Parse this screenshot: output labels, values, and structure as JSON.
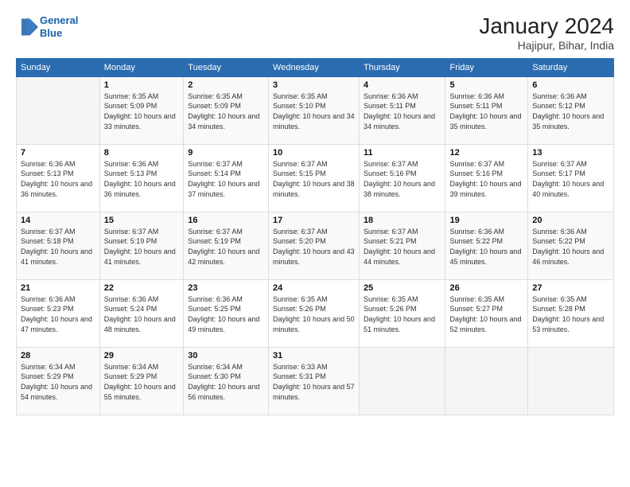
{
  "logo": {
    "line1": "General",
    "line2": "Blue"
  },
  "title": "January 2024",
  "subtitle": "Hajipur, Bihar, India",
  "days_header": [
    "Sunday",
    "Monday",
    "Tuesday",
    "Wednesday",
    "Thursday",
    "Friday",
    "Saturday"
  ],
  "weeks": [
    [
      {
        "num": "",
        "sunrise": "",
        "sunset": "",
        "daylight": ""
      },
      {
        "num": "1",
        "sunrise": "Sunrise: 6:35 AM",
        "sunset": "Sunset: 5:09 PM",
        "daylight": "Daylight: 10 hours and 33 minutes."
      },
      {
        "num": "2",
        "sunrise": "Sunrise: 6:35 AM",
        "sunset": "Sunset: 5:09 PM",
        "daylight": "Daylight: 10 hours and 34 minutes."
      },
      {
        "num": "3",
        "sunrise": "Sunrise: 6:35 AM",
        "sunset": "Sunset: 5:10 PM",
        "daylight": "Daylight: 10 hours and 34 minutes."
      },
      {
        "num": "4",
        "sunrise": "Sunrise: 6:36 AM",
        "sunset": "Sunset: 5:11 PM",
        "daylight": "Daylight: 10 hours and 34 minutes."
      },
      {
        "num": "5",
        "sunrise": "Sunrise: 6:36 AM",
        "sunset": "Sunset: 5:11 PM",
        "daylight": "Daylight: 10 hours and 35 minutes."
      },
      {
        "num": "6",
        "sunrise": "Sunrise: 6:36 AM",
        "sunset": "Sunset: 5:12 PM",
        "daylight": "Daylight: 10 hours and 35 minutes."
      }
    ],
    [
      {
        "num": "7",
        "sunrise": "Sunrise: 6:36 AM",
        "sunset": "Sunset: 5:13 PM",
        "daylight": "Daylight: 10 hours and 36 minutes."
      },
      {
        "num": "8",
        "sunrise": "Sunrise: 6:36 AM",
        "sunset": "Sunset: 5:13 PM",
        "daylight": "Daylight: 10 hours and 36 minutes."
      },
      {
        "num": "9",
        "sunrise": "Sunrise: 6:37 AM",
        "sunset": "Sunset: 5:14 PM",
        "daylight": "Daylight: 10 hours and 37 minutes."
      },
      {
        "num": "10",
        "sunrise": "Sunrise: 6:37 AM",
        "sunset": "Sunset: 5:15 PM",
        "daylight": "Daylight: 10 hours and 38 minutes."
      },
      {
        "num": "11",
        "sunrise": "Sunrise: 6:37 AM",
        "sunset": "Sunset: 5:16 PM",
        "daylight": "Daylight: 10 hours and 38 minutes."
      },
      {
        "num": "12",
        "sunrise": "Sunrise: 6:37 AM",
        "sunset": "Sunset: 5:16 PM",
        "daylight": "Daylight: 10 hours and 39 minutes."
      },
      {
        "num": "13",
        "sunrise": "Sunrise: 6:37 AM",
        "sunset": "Sunset: 5:17 PM",
        "daylight": "Daylight: 10 hours and 40 minutes."
      }
    ],
    [
      {
        "num": "14",
        "sunrise": "Sunrise: 6:37 AM",
        "sunset": "Sunset: 5:18 PM",
        "daylight": "Daylight: 10 hours and 41 minutes."
      },
      {
        "num": "15",
        "sunrise": "Sunrise: 6:37 AM",
        "sunset": "Sunset: 5:19 PM",
        "daylight": "Daylight: 10 hours and 41 minutes."
      },
      {
        "num": "16",
        "sunrise": "Sunrise: 6:37 AM",
        "sunset": "Sunset: 5:19 PM",
        "daylight": "Daylight: 10 hours and 42 minutes."
      },
      {
        "num": "17",
        "sunrise": "Sunrise: 6:37 AM",
        "sunset": "Sunset: 5:20 PM",
        "daylight": "Daylight: 10 hours and 43 minutes."
      },
      {
        "num": "18",
        "sunrise": "Sunrise: 6:37 AM",
        "sunset": "Sunset: 5:21 PM",
        "daylight": "Daylight: 10 hours and 44 minutes."
      },
      {
        "num": "19",
        "sunrise": "Sunrise: 6:36 AM",
        "sunset": "Sunset: 5:22 PM",
        "daylight": "Daylight: 10 hours and 45 minutes."
      },
      {
        "num": "20",
        "sunrise": "Sunrise: 6:36 AM",
        "sunset": "Sunset: 5:22 PM",
        "daylight": "Daylight: 10 hours and 46 minutes."
      }
    ],
    [
      {
        "num": "21",
        "sunrise": "Sunrise: 6:36 AM",
        "sunset": "Sunset: 5:23 PM",
        "daylight": "Daylight: 10 hours and 47 minutes."
      },
      {
        "num": "22",
        "sunrise": "Sunrise: 6:36 AM",
        "sunset": "Sunset: 5:24 PM",
        "daylight": "Daylight: 10 hours and 48 minutes."
      },
      {
        "num": "23",
        "sunrise": "Sunrise: 6:36 AM",
        "sunset": "Sunset: 5:25 PM",
        "daylight": "Daylight: 10 hours and 49 minutes."
      },
      {
        "num": "24",
        "sunrise": "Sunrise: 6:35 AM",
        "sunset": "Sunset: 5:26 PM",
        "daylight": "Daylight: 10 hours and 50 minutes."
      },
      {
        "num": "25",
        "sunrise": "Sunrise: 6:35 AM",
        "sunset": "Sunset: 5:26 PM",
        "daylight": "Daylight: 10 hours and 51 minutes."
      },
      {
        "num": "26",
        "sunrise": "Sunrise: 6:35 AM",
        "sunset": "Sunset: 5:27 PM",
        "daylight": "Daylight: 10 hours and 52 minutes."
      },
      {
        "num": "27",
        "sunrise": "Sunrise: 6:35 AM",
        "sunset": "Sunset: 5:28 PM",
        "daylight": "Daylight: 10 hours and 53 minutes."
      }
    ],
    [
      {
        "num": "28",
        "sunrise": "Sunrise: 6:34 AM",
        "sunset": "Sunset: 5:29 PM",
        "daylight": "Daylight: 10 hours and 54 minutes."
      },
      {
        "num": "29",
        "sunrise": "Sunrise: 6:34 AM",
        "sunset": "Sunset: 5:29 PM",
        "daylight": "Daylight: 10 hours and 55 minutes."
      },
      {
        "num": "30",
        "sunrise": "Sunrise: 6:34 AM",
        "sunset": "Sunset: 5:30 PM",
        "daylight": "Daylight: 10 hours and 56 minutes."
      },
      {
        "num": "31",
        "sunrise": "Sunrise: 6:33 AM",
        "sunset": "Sunset: 5:31 PM",
        "daylight": "Daylight: 10 hours and 57 minutes."
      },
      {
        "num": "",
        "sunrise": "",
        "sunset": "",
        "daylight": ""
      },
      {
        "num": "",
        "sunrise": "",
        "sunset": "",
        "daylight": ""
      },
      {
        "num": "",
        "sunrise": "",
        "sunset": "",
        "daylight": ""
      }
    ]
  ]
}
